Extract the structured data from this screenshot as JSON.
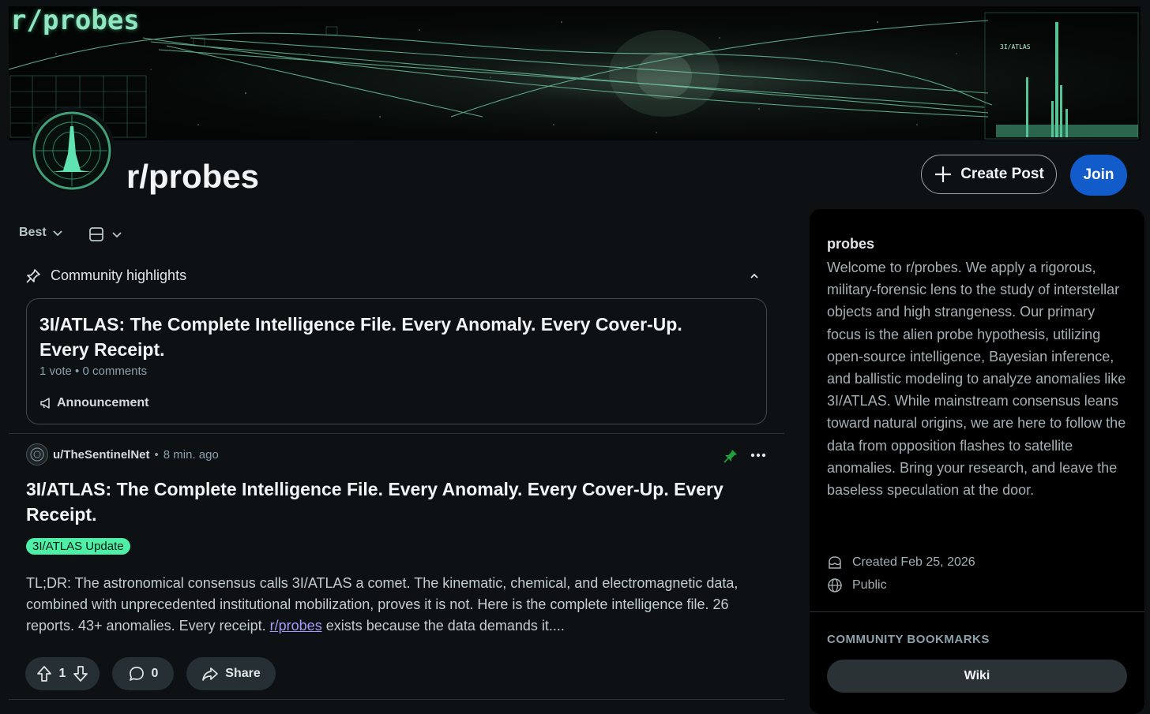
{
  "banner": {
    "title": "r/probes",
    "chart_label": "3I/ATLAS"
  },
  "header": {
    "subreddit_name": "r/probes",
    "create_post_label": "Create Post",
    "join_label": "Join"
  },
  "feed_controls": {
    "sort_label": "Best"
  },
  "highlights": {
    "heading": "Community highlights",
    "card": {
      "title": "3I/ATLAS: The Complete Intelligence File. Every Anomaly. Every Cover-Up. Every Receipt.",
      "votes": "1 vote",
      "separator": "•",
      "comments": "0 comments",
      "tag": "Announcement"
    }
  },
  "post": {
    "author": "u/TheSentinelNet",
    "separator": "•",
    "time": "8 min. ago",
    "title": "3I/ATLAS: The Complete Intelligence File. Every Anomaly. Every Cover-Up. Every Receipt.",
    "flair": "3I/ATLAS Update",
    "body_before_link": "TL;DR: The astronomical consensus calls 3I/ATLAS a comet. The kinematic, chemical, and electromagnetic data, combined with unprecedented institutional mobilization, proves it is not. Here is the complete intelligence file. 26 reports. 43+ anomalies. Every receipt. ",
    "body_link": "r/probes",
    "body_after_link": " exists because the data demands it....",
    "vote_count": "1",
    "comment_count": "0",
    "share_label": "Share"
  },
  "sidebar": {
    "name": "probes",
    "description": "Welcome to r/probes. We apply a rigorous, military-forensic lens to the study of interstellar objects and high strangeness. Our primary focus is the alien probe hypothesis, utilizing open-source intelligence, Bayesian inference, and ballistic modeling to analyze anomalies like 3I/ATLAS. While mainstream consensus leans toward natural origins, we are here to follow the data from opposition flashes to satellite anomalies. Bring your research, and leave the baseless speculation at the door.",
    "created": "Created Feb 25, 2026",
    "visibility": "Public",
    "bookmarks_title": "COMMUNITY BOOKMARKS",
    "wiki_label": "Wiki"
  },
  "colors": {
    "background": "#0e1113",
    "join_blue": "#115bca",
    "flair_green": "#4ef0a7",
    "link_purple": "#a99cf8",
    "banner_glow": "#8fe6c0"
  },
  "icons": [
    "plus-icon",
    "chevron-down-icon",
    "card-view-icon",
    "pin-icon",
    "chevron-up-icon",
    "megaphone-icon",
    "more-icon",
    "upvote-icon",
    "downvote-icon",
    "comment-icon",
    "share-icon",
    "cake-icon",
    "globe-icon"
  ]
}
